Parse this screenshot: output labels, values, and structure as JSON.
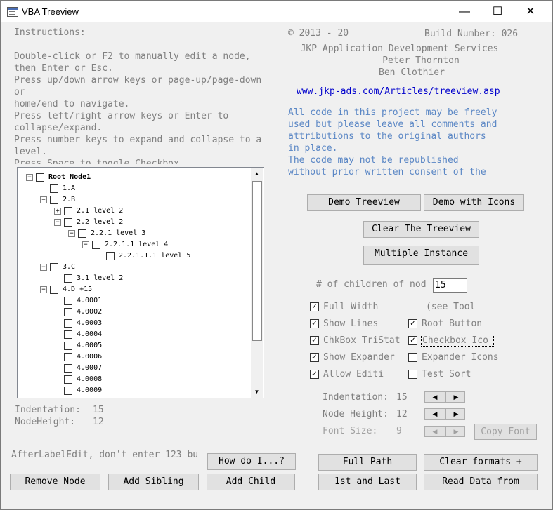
{
  "window": {
    "title": "VBA Treeview",
    "min_glyph": "—",
    "max_glyph": "☐",
    "close_glyph": "✕"
  },
  "instructions": {
    "heading": "Instructions:",
    "lines": [
      "Double-click or F2 to manually edit a node,",
      "then Enter or Esc.",
      "Press up/down arrow keys or page-up/page-down",
      "or",
      "home/end to navigate.",
      "Press left/right arrow keys or Enter to",
      "collapse/expand.",
      "Press number keys to expand and collapse to a",
      "level.",
      "Press Space to toggle Checkbox"
    ]
  },
  "about": {
    "copyright": "© 2013 - 20",
    "build": "Build Number: 026",
    "company": "JKP Application Development Services",
    "author1": "Peter Thornton",
    "author2": "Ben Clothier",
    "url": "www.jkp-ads.com/Articles/treeview.asp",
    "license_lines": [
      "All code in this project may be freely",
      "used but please leave all comments and",
      "attributions to the original authors",
      "in place.",
      "The code may not be republished",
      "without prior written consent of the"
    ]
  },
  "tree": {
    "nodes": [
      {
        "text": "Root Node1",
        "toggle": "−",
        "bold": true
      },
      {
        "text": "1.A",
        "toggle": ""
      },
      {
        "text": "2.B",
        "toggle": "−"
      },
      {
        "text": "2.1  level 2",
        "toggle": "+"
      },
      {
        "text": "2.2  level 2",
        "toggle": "−"
      },
      {
        "text": "2.2.1  level 3",
        "toggle": "−"
      },
      {
        "text": "2.2.1.1  level 4",
        "toggle": "−"
      },
      {
        "text": "2.2.1.1.1   level 5",
        "toggle": ""
      },
      {
        "text": "3.C",
        "toggle": "−"
      },
      {
        "text": "3.1  level 2",
        "toggle": ""
      },
      {
        "text": "4.D  +15",
        "toggle": "−"
      },
      {
        "text": "4.0001",
        "toggle": ""
      },
      {
        "text": "4.0002",
        "toggle": ""
      },
      {
        "text": "4.0003",
        "toggle": ""
      },
      {
        "text": "4.0004",
        "toggle": ""
      },
      {
        "text": "4.0005",
        "toggle": ""
      },
      {
        "text": "4.0006",
        "toggle": ""
      },
      {
        "text": "4.0007",
        "toggle": ""
      },
      {
        "text": "4.0008",
        "toggle": ""
      },
      {
        "text": "4.0009",
        "toggle": ""
      }
    ],
    "scroll_up": "▲",
    "scroll_down": "▼"
  },
  "status": {
    "indentation_label": "Indentation:",
    "indentation_value": "15",
    "nodeheight_label": "NodeHeight:",
    "nodeheight_value": "12",
    "after_label_edit": "AfterLabelEdit, don't enter 123 bu"
  },
  "buttons": {
    "demo_treeview": "Demo Treeview",
    "demo_icons": "Demo with Icons",
    "clear_treeview": "Clear The Treeview",
    "multiple_instance": "Multiple Instance",
    "copy_font": "Copy Font",
    "how_do_i": "How do I...?",
    "full_path": "Full Path",
    "clear_formats": "Clear formats +",
    "remove_node": "Remove Node",
    "add_sibling": "Add Sibling",
    "add_child": "Add Child",
    "first_last": "1st and Last",
    "read_data": "Read Data from"
  },
  "options": {
    "children_label": "# of children of nod",
    "children_value": "15",
    "full_width": "Full Width",
    "see_tool": "(see Tool",
    "show_lines": "Show Lines",
    "root_button": "Root Button",
    "chkbox_tristate": "ChkBox TriStat",
    "checkbox_icons": "Checkbox Ico",
    "show_expander": "Show Expander",
    "expander_icons": "Expander Icons",
    "allow_edit": "Allow Editi",
    "test_sort": "Test Sort",
    "check_glyph": "✓",
    "indentation_label": "Indentation:",
    "indentation_value": "15",
    "node_height_label": "Node Height:",
    "node_height_value": "12",
    "font_size_label": "Font Size:",
    "font_size_value": "9",
    "spin_left": "◀",
    "spin_right": "▶"
  }
}
